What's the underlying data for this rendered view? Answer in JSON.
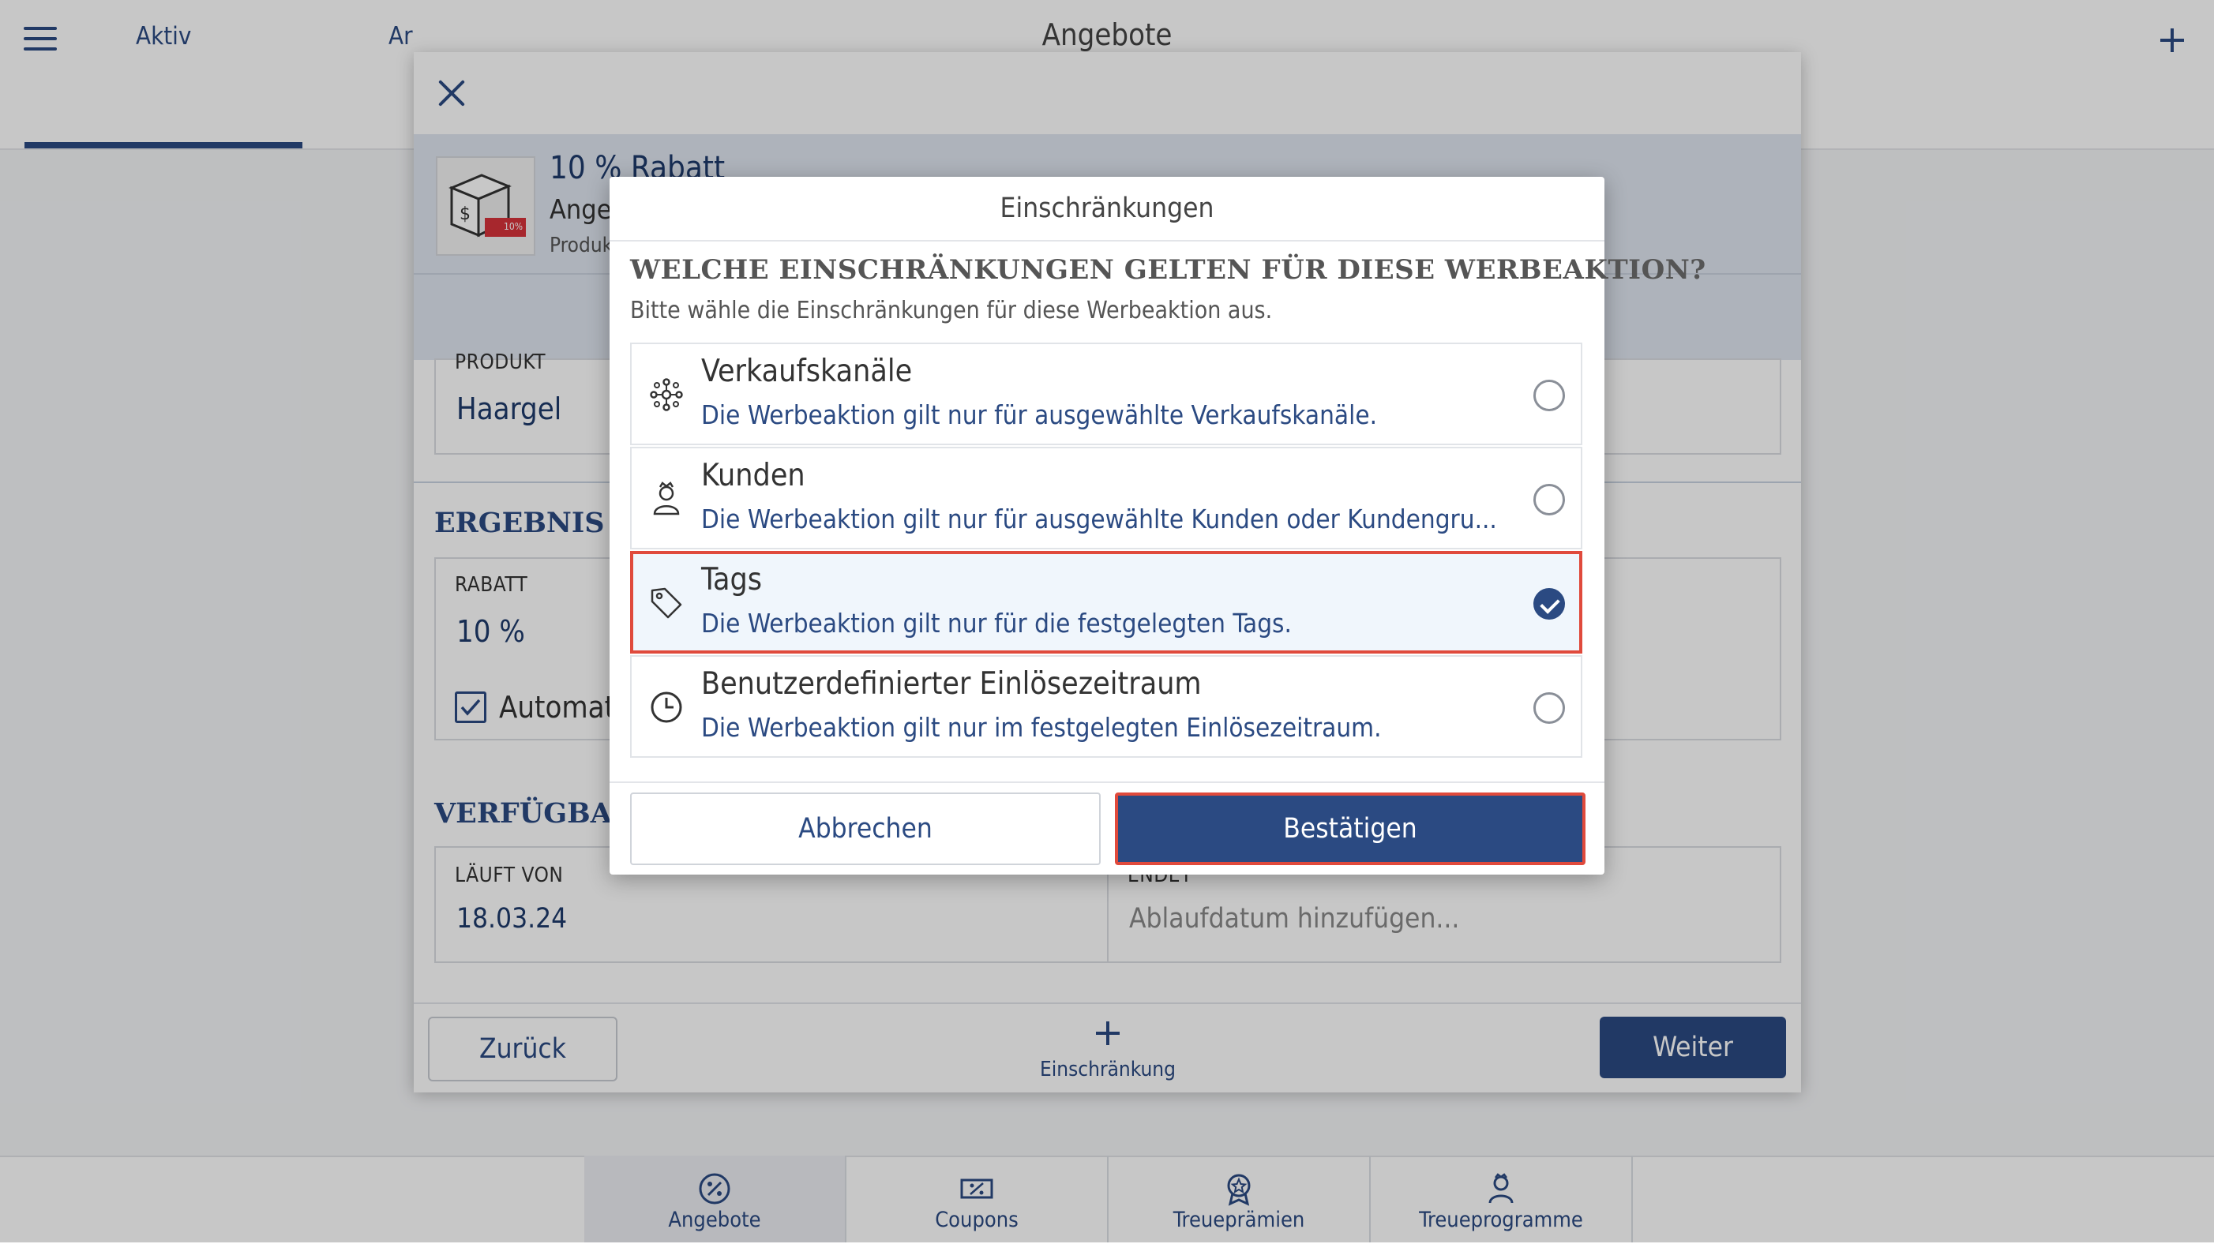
{
  "app": {
    "title": "Angebote",
    "tabs": [
      {
        "label": "Aktiv"
      },
      {
        "label": "Ar"
      }
    ]
  },
  "bottom_nav": {
    "items": [
      {
        "label": "Angebote",
        "icon": "percent-badge-icon"
      },
      {
        "label": "Coupons",
        "icon": "coupon-icon"
      },
      {
        "label": "Treueprämien",
        "icon": "award-icon"
      },
      {
        "label": "Treueprogramme",
        "icon": "member-icon"
      }
    ]
  },
  "offer_dialog": {
    "offer_name": "10 % Rabatt",
    "offer_type": "Ange",
    "offer_product_small": "Produk",
    "thumbnail_badge": "10%",
    "product": {
      "label": "PRODUKT",
      "value": "Haargel"
    },
    "result_section_title": "ERGEBNIS DES",
    "discount": {
      "label": "RABATT",
      "value": "10 %"
    },
    "auto_checkbox_label": "Automat",
    "availability_section_title": "VERFÜGBARK",
    "runs_from": {
      "label": "LÄUFT VON",
      "value": "18.03.24"
    },
    "ends": {
      "label": "ENDET",
      "placeholder": "Ablaufdatum hinzufügen..."
    },
    "back_label": "Zurück",
    "next_label": "Weiter",
    "add_restriction_label": "Einschränkung"
  },
  "restrictions_dialog": {
    "title": "Einschränkungen",
    "question": "WELCHE EINSCHRÄNKUNGEN GELTEN FÜR DIESE WERBEAKTION?",
    "hint": "Bitte wähle die Einschränkungen für diese Werbeaktion aus.",
    "options": [
      {
        "title": "Verkaufskanäle",
        "description": "Die Werbeaktion gilt nur für ausgewählte Verkaufskanäle.",
        "icon": "sales-channels-icon",
        "selected": false
      },
      {
        "title": "Kunden",
        "description": "Die Werbeaktion gilt nur für ausgewählte Kunden oder Kundengru...",
        "icon": "customer-icon",
        "selected": false
      },
      {
        "title": "Tags",
        "description": "Die Werbeaktion gilt nur für die festgelegten Tags.",
        "icon": "tag-icon",
        "selected": true
      },
      {
        "title": "Benutzerdefinierter Einlösezeitraum",
        "description": "Die Werbeaktion gilt nur im festgelegten Einlösezeitraum.",
        "icon": "clock-icon",
        "selected": false
      }
    ],
    "cancel_label": "Abbrechen",
    "confirm_label": "Bestätigen"
  },
  "colors": {
    "primary": "#2b4a82",
    "highlight": "#e04a3c",
    "selected_bg": "#f0f6fc"
  }
}
